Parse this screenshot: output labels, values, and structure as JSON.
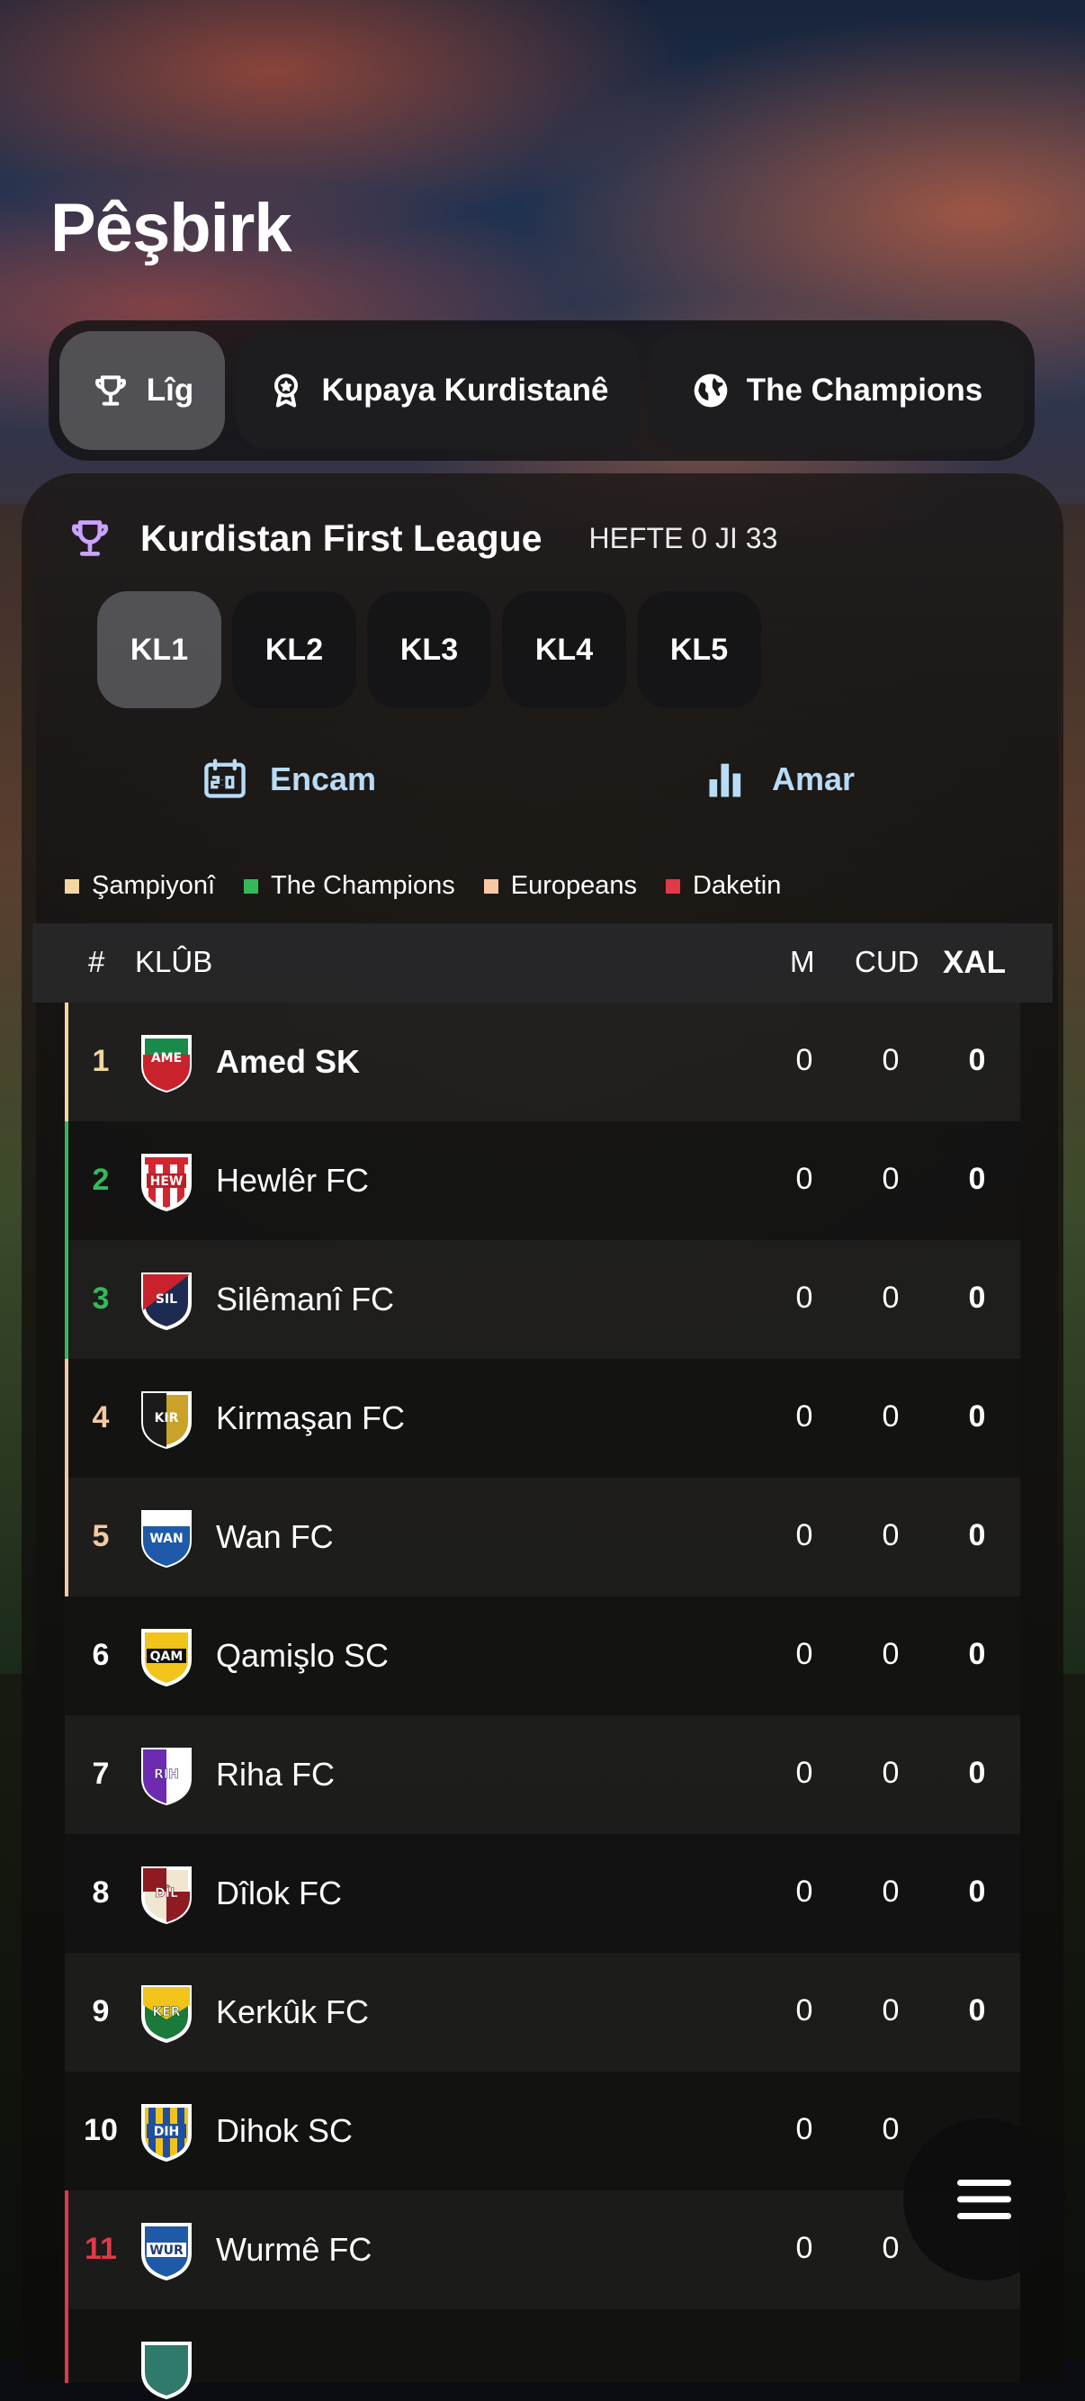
{
  "page": {
    "title": "Pêşbirk"
  },
  "tabs": [
    {
      "label": "Lîg",
      "icon": "trophy-icon",
      "active": true
    },
    {
      "label": "Kupaya Kurdistanê",
      "icon": "award-icon",
      "active": false
    },
    {
      "label": "The Champions",
      "icon": "globe-icon",
      "active": false
    }
  ],
  "league": {
    "icon": "trophy-icon",
    "name": "Kurdistan First League",
    "week": "HEFTE 0 JI 33"
  },
  "subtabs": [
    {
      "label": "KL1",
      "active": true
    },
    {
      "label": "KL2",
      "active": false
    },
    {
      "label": "KL3",
      "active": false
    },
    {
      "label": "KL4",
      "active": false
    },
    {
      "label": "KL5",
      "active": false
    }
  ],
  "actions": {
    "results": "Encam",
    "stats": "Amar"
  },
  "legend": [
    {
      "label": "Şampiyonî",
      "color": "#f4d6a0"
    },
    {
      "label": "The Champions",
      "color": "#35b85a"
    },
    {
      "label": "Europeans",
      "color": "#f6c9a2"
    },
    {
      "label": "Daketin",
      "color": "#e0394a"
    }
  ],
  "table": {
    "headers": {
      "rank": "#",
      "club": "KLÛB",
      "played": "M",
      "goal_diff": "CUD",
      "points": "XAL"
    },
    "rows": [
      {
        "pos": "1",
        "abbr": "AME",
        "name": "Amed SK",
        "m": "0",
        "cud": "0",
        "xal": "0"
      },
      {
        "pos": "2",
        "abbr": "HEW",
        "name": "Hewlêr FC",
        "m": "0",
        "cud": "0",
        "xal": "0"
      },
      {
        "pos": "3",
        "abbr": "SIL",
        "name": "Silêmanî FC",
        "m": "0",
        "cud": "0",
        "xal": "0"
      },
      {
        "pos": "4",
        "abbr": "KIR",
        "name": "Kirmaşan FC",
        "m": "0",
        "cud": "0",
        "xal": "0"
      },
      {
        "pos": "5",
        "abbr": "WAN",
        "name": "Wan FC",
        "m": "0",
        "cud": "0",
        "xal": "0"
      },
      {
        "pos": "6",
        "abbr": "QAM",
        "name": "Qamişlo SC",
        "m": "0",
        "cud": "0",
        "xal": "0"
      },
      {
        "pos": "7",
        "abbr": "RIH",
        "name": "Riha FC",
        "m": "0",
        "cud": "0",
        "xal": "0"
      },
      {
        "pos": "8",
        "abbr": "DÎL",
        "name": "Dîlok FC",
        "m": "0",
        "cud": "0",
        "xal": "0"
      },
      {
        "pos": "9",
        "abbr": "KER",
        "name": "Kerkûk FC",
        "m": "0",
        "cud": "0",
        "xal": "0"
      },
      {
        "pos": "10",
        "abbr": "DIH",
        "name": "Dihok SC",
        "m": "0",
        "cud": "0",
        "xal": ""
      },
      {
        "pos": "11",
        "abbr": "WUR",
        "name": "Wurmê FC",
        "m": "0",
        "cud": "0",
        "xal": ""
      }
    ]
  },
  "menu_button": {
    "icon": "menu-icon"
  }
}
